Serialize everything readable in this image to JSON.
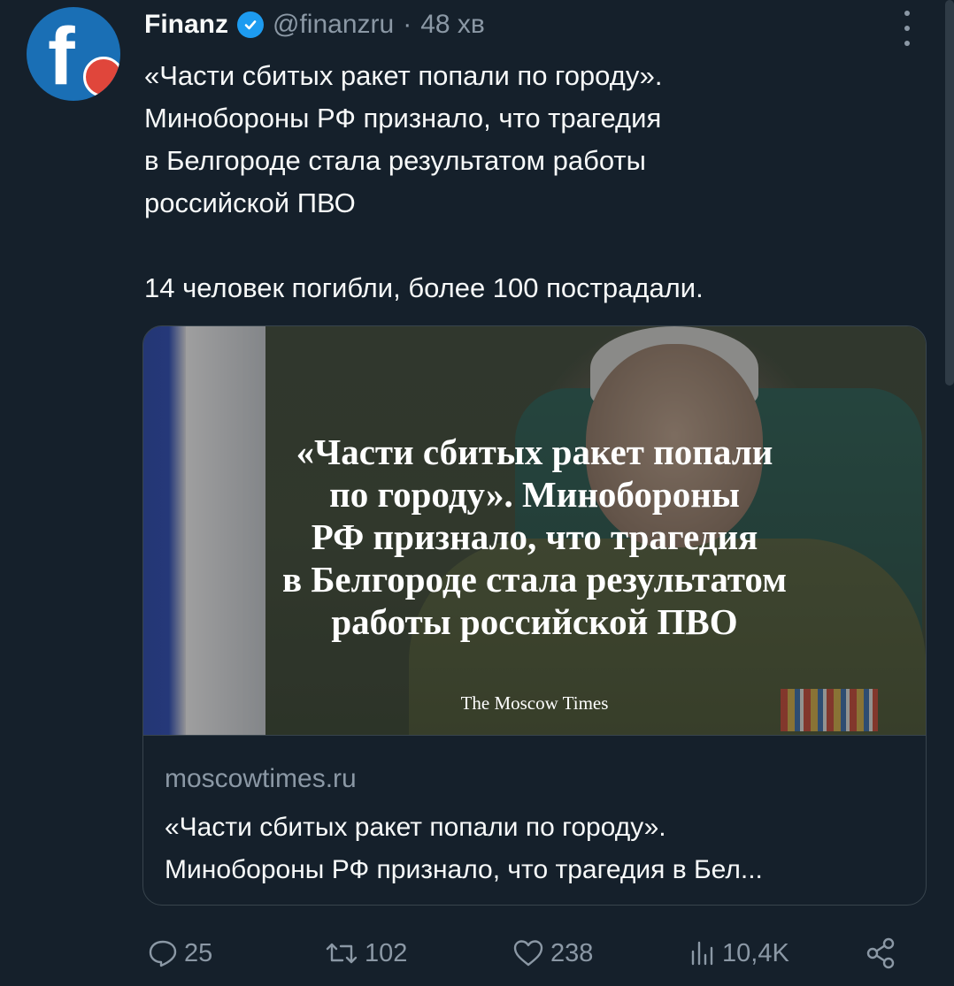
{
  "author": {
    "name": "Finanz",
    "handle": "@finanzru",
    "separator": "·",
    "time": "48 хв",
    "avatar_letter": "f"
  },
  "tweet": {
    "text": "«Части сбитых ракет попали по городу».\nМинобороны РФ признало, что трагедия\nв Белгороде стала результатом работы\nроссийской ПВО\n\n14 человек погибли, более 100 пострадали."
  },
  "card": {
    "image_headline": "«Части сбитых ракет попали\nпо городу». Минобороны\nРФ признало, что трагедия\nв Белгороде стала результатом\nработы российской ПВО",
    "image_brand": "The Moscow Times",
    "domain": "moscowtimes.ru",
    "title_line1": "«Части сбитых ракет попали по городу».",
    "title_line2": "Минобороны РФ признало, что трагедия в Бел..."
  },
  "actions": {
    "replies": "25",
    "reposts": "102",
    "likes": "238",
    "views": "10,4K"
  },
  "colors": {
    "background": "#15202b",
    "muted": "#8b98a5",
    "verified": "#1d9bf0",
    "border": "#38444d"
  }
}
